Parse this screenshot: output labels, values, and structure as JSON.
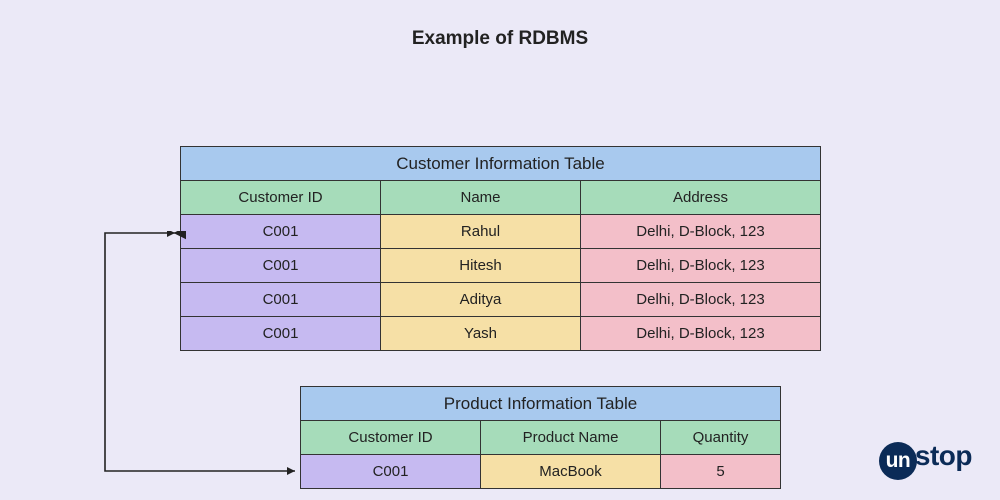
{
  "title": "Example of RDBMS",
  "customer_table": {
    "caption": "Customer Information Table",
    "headers": [
      "Customer ID",
      "Name",
      "Address"
    ],
    "rows": [
      [
        "C001",
        "Rahul",
        "Delhi, D-Block, 123"
      ],
      [
        "C001",
        "Hitesh",
        "Delhi, D-Block, 123"
      ],
      [
        "C001",
        "Aditya",
        "Delhi, D-Block, 123"
      ],
      [
        "C001",
        "Yash",
        "Delhi, D-Block, 123"
      ]
    ]
  },
  "product_table": {
    "caption": "Product Information Table",
    "headers": [
      "Customer ID",
      "Product Name",
      "Quantity"
    ],
    "rows": [
      [
        "C001",
        "MacBook",
        "5"
      ]
    ]
  },
  "logo": {
    "prefix": "un",
    "suffix": "stop"
  },
  "colors": {
    "page_bg": "#ebe9f7",
    "caption_bg": "#a8c9ee",
    "header_bg": "#a6dcba",
    "col_id_bg": "#c6baf1",
    "col_name_bg": "#f6e0a6",
    "col_addr_bg": "#f3bfc9",
    "border": "#333",
    "logo": "#0b2b57"
  },
  "chart_data": {
    "type": "table",
    "title": "Example of RDBMS",
    "tables": [
      {
        "name": "Customer Information Table",
        "columns": [
          "Customer ID",
          "Name",
          "Address"
        ],
        "rows": [
          [
            "C001",
            "Rahul",
            "Delhi, D-Block, 123"
          ],
          [
            "C001",
            "Hitesh",
            "Delhi, D-Block, 123"
          ],
          [
            "C001",
            "Aditya",
            "Delhi, D-Block, 123"
          ],
          [
            "C001",
            "Yash",
            "Delhi, D-Block, 123"
          ]
        ]
      },
      {
        "name": "Product Information Table",
        "columns": [
          "Customer ID",
          "Product Name",
          "Quantity"
        ],
        "rows": [
          [
            "C001",
            "MacBook",
            5
          ]
        ]
      }
    ],
    "relationship": {
      "from": {
        "table": "Customer Information Table",
        "column": "Customer ID"
      },
      "to": {
        "table": "Product Information Table",
        "column": "Customer ID"
      }
    }
  }
}
